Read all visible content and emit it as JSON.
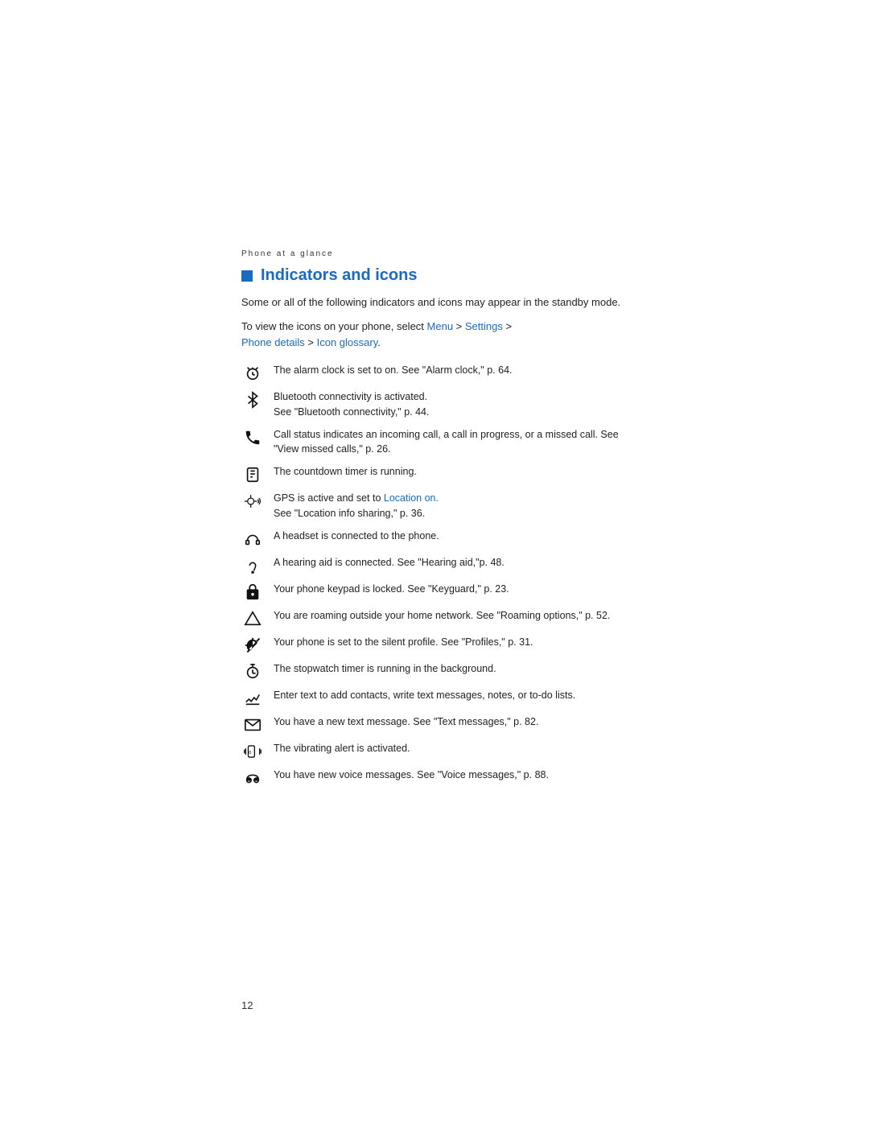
{
  "page": {
    "section_label": "Phone at a glance",
    "title": "Indicators and icons",
    "intro": "Some or all of the following indicators and icons may appear in the standby mode.",
    "nav_line1": "To view the icons on your phone, select ",
    "nav_menu": "Menu",
    "nav_sep1": " > ",
    "nav_settings": "Settings",
    "nav_sep2": " > ",
    "nav_phone_details": "Phone details",
    "nav_sep3": " > ",
    "nav_icon_glossary": "Icon glossary",
    "nav_end": ".",
    "page_number": "12",
    "items": [
      {
        "icon": "alarm",
        "desc": "The alarm clock is set to on. See \"Alarm clock,\" p. 64."
      },
      {
        "icon": "bluetooth",
        "desc": "Bluetooth connectivity is activated. See \"Bluetooth connectivity,\" p. 44."
      },
      {
        "icon": "call",
        "desc": "Call status indicates an incoming call, a call in progress, or a missed call.  See \"View missed calls,\" p. 26."
      },
      {
        "icon": "countdown",
        "desc": "The countdown timer is running."
      },
      {
        "icon": "gps",
        "desc": "GPS is active and set to Location on. See \"Location info sharing,\" p. 36.",
        "link_text": "Location on."
      },
      {
        "icon": "headset",
        "desc": "A headset is connected to the phone."
      },
      {
        "icon": "hearing-aid",
        "desc": "A hearing aid is connected. See \"Hearing aid,\"p. 48."
      },
      {
        "icon": "keyguard",
        "desc": "Your phone keypad is locked. See \"Keyguard,\" p. 23."
      },
      {
        "icon": "roaming",
        "desc": "You are roaming outside your home network. See \"Roaming options,\" p. 52."
      },
      {
        "icon": "silent",
        "desc": "Your phone is set to the silent profile. See \"Profiles,\" p. 31."
      },
      {
        "icon": "stopwatch",
        "desc": "The stopwatch timer is running in the background."
      },
      {
        "icon": "contacts",
        "desc": "Enter text to add contacts, write text messages, notes, or to-do lists."
      },
      {
        "icon": "text-message",
        "desc": "You have a new text message. See \"Text messages,\" p. 82."
      },
      {
        "icon": "vibrate",
        "desc": "The vibrating alert is activated."
      },
      {
        "icon": "voice-message",
        "desc": "You have new voice messages. See \"Voice messages,\" p. 88."
      }
    ]
  }
}
